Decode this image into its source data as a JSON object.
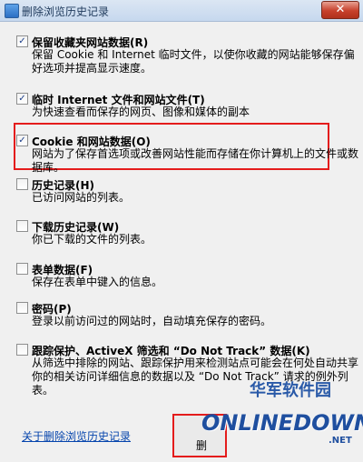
{
  "window": {
    "title": "删除浏览历史记录",
    "close_glyph": "✕"
  },
  "options": [
    {
      "checked": true,
      "title": "保留收藏夹网站数据(R)",
      "desc": "保留 Cookie 和 Internet 临时文件，以使你收藏的网站能够保存偏好选项并提高显示速度。"
    },
    {
      "checked": true,
      "title": "临时 Internet 文件和网站文件(T)",
      "desc": "为快速查看而保存的网页、图像和媒体的副本"
    },
    {
      "checked": true,
      "title": "Cookie 和网站数据(O)",
      "desc": "网站为了保存首选项或改善网站性能而存储在你计算机上的文件或数据库。"
    },
    {
      "checked": false,
      "title": "历史记录(H)",
      "desc": "已访问网站的列表。"
    },
    {
      "checked": false,
      "title": "下载历史记录(W)",
      "desc": "你已下载的文件的列表。"
    },
    {
      "checked": false,
      "title": "表单数据(F)",
      "desc": "保存在表单中键入的信息。"
    },
    {
      "checked": false,
      "title": "密码(P)",
      "desc": "登录以前访问过的网站时，自动填充保存的密码。"
    },
    {
      "checked": false,
      "title": "跟踪保护、ActiveX 筛选和 “Do Not Track” 数据(K)",
      "desc": "从筛选中排除的网站、跟踪保护用来检测站点可能会在何处自动共享你的相关访问详细信息的数据以及 “Do Not Track” 请求的例外列表。"
    }
  ],
  "footer": {
    "link": "关于删除浏览历史记录",
    "delete_button": "删"
  },
  "watermark": {
    "cn": "华军软件园",
    "en": "ONLINEDOWN",
    "net": ".NET"
  },
  "checkmark": "✓",
  "colors": {
    "highlight": "#e41c1c",
    "link": "#0645ad"
  }
}
